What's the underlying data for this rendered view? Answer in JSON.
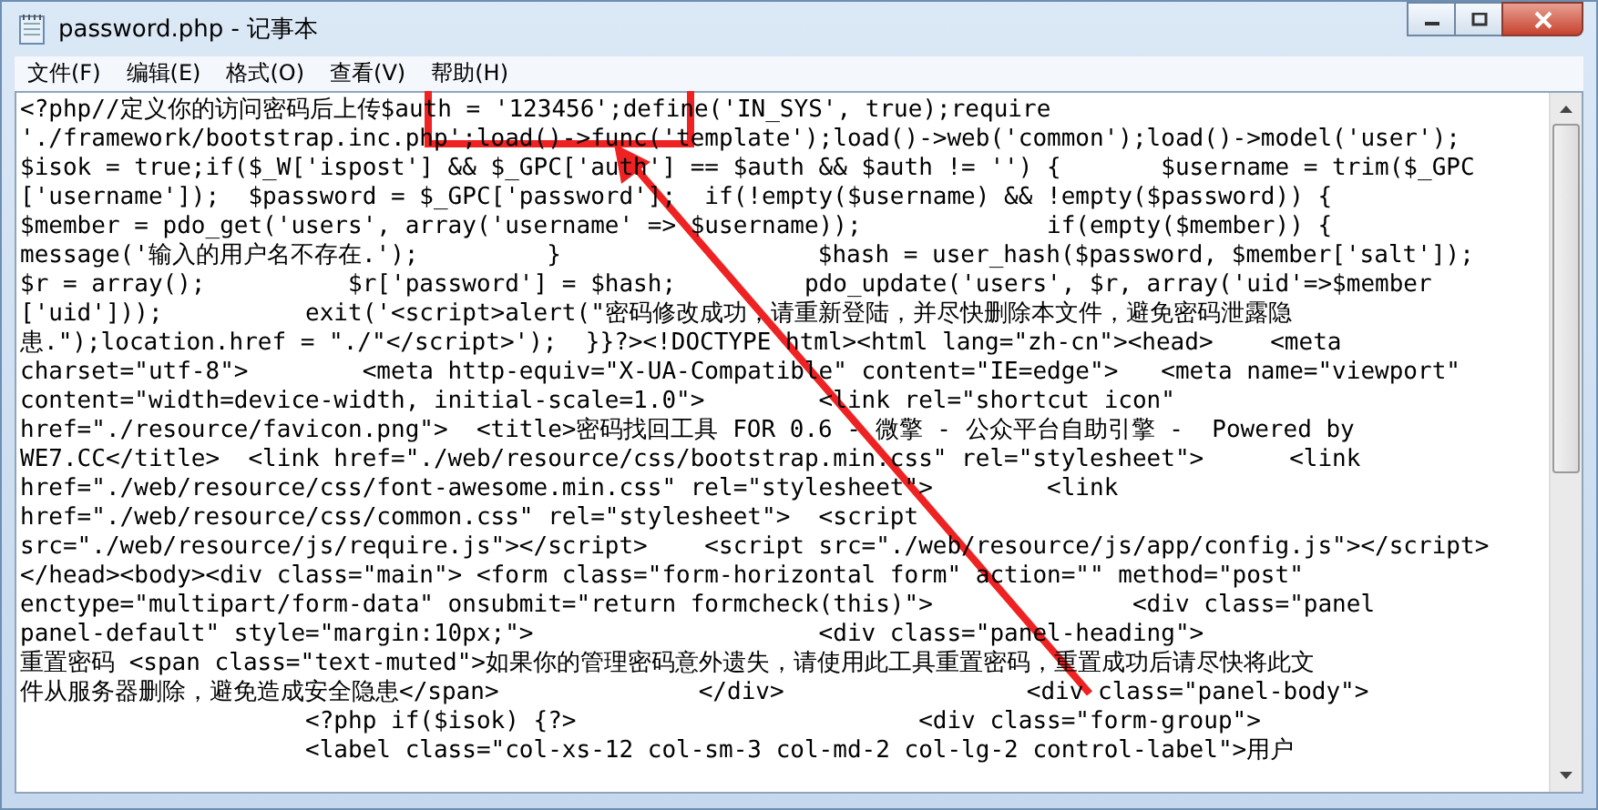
{
  "window": {
    "title": "password.php - 记事本"
  },
  "menu": [
    "文件(F)",
    "编辑(E)",
    "格式(O)",
    "查看(V)",
    "帮助(H)"
  ],
  "editor": {
    "lines": [
      "<?php//定义你的访问密码后上传$auth = '123456';define('IN_SYS', true);require",
      "'./framework/bootstrap.inc.php';load()->func('template');load()->web('common');load()->model('user');",
      "$isok = true;if($_W['ispost'] && $_GPC['auth'] == $auth && $auth != '') {       $username = trim($_GPC",
      "['username']);  $password = $_GPC['password'];  if(!empty($username) && !empty($password)) {",
      "$member = pdo_get('users', array('username' => $username));             if(empty($member)) {",
      "message('输入的用户名不存在.');         }                  $hash = user_hash($password, $member['salt']);",
      "$r = array();          $r['password'] = $hash;         pdo_update('users', $r, array('uid'=>$member",
      "['uid']));          exit('<script>alert(\"密码修改成功，请重新登陆，并尽快删除本文件，避免密码泄露隐",
      "患.\");location.href = \"./\"</script>');  }}?><!DOCTYPE html><html lang=\"zh-cn\"><head>    <meta",
      "charset=\"utf-8\">        <meta http-equiv=\"X-UA-Compatible\" content=\"IE=edge\">   <meta name=\"viewport\"",
      "content=\"width=device-width, initial-scale=1.0\">        <link rel=\"shortcut icon\"",
      "href=\"./resource/favicon.png\">  <title>密码找回工具 FOR 0.6 - 微擎 - 公众平台自助引擎 -  Powered by",
      "WE7.CC</title>  <link href=\"./web/resource/css/bootstrap.min.css\" rel=\"stylesheet\">      <link",
      "href=\"./web/resource/css/font-awesome.min.css\" rel=\"stylesheet\">        <link",
      "href=\"./web/resource/css/common.css\" rel=\"stylesheet\">  <script",
      "src=\"./web/resource/js/require.js\"></script>    <script src=\"./web/resource/js/app/config.js\"></script>",
      "</head><body><div class=\"main\"> <form class=\"form-horizontal form\" action=\"\" method=\"post\"",
      "enctype=\"multipart/form-data\" onsubmit=\"return formcheck(this)\">              <div class=\"panel",
      "panel-default\" style=\"margin:10px;\">                    <div class=\"panel-heading\">",
      "重置密码 <span class=\"text-muted\">如果你的管理密码意外遗失，请使用此工具重置密码，重置成功后请尽快将此文",
      "件从服务器删除，避免造成安全隐患</span>              </div>                 <div class=\"panel-body\">",
      "                    <?php if($isok) {?>                        <div class=\"form-group\">",
      "                    <label class=\"col-xs-12 col-sm-3 col-md-2 col-lg-2 control-label\">用户"
    ]
  }
}
